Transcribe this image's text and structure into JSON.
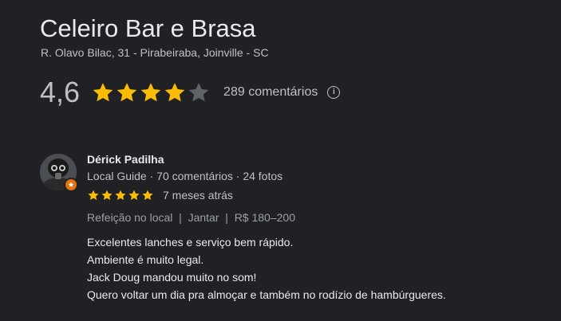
{
  "place": {
    "name": "Celeiro Bar e Brasa",
    "address": "R. Olavo Bilac, 31 - Pirabeiraba, Joinville - SC"
  },
  "rating": {
    "value": "4,6",
    "stars": 4.6,
    "count_label": "289 comentários",
    "star_color": "#fbbc04",
    "empty_star_color": "#5f6368",
    "info_icon": "info-icon"
  },
  "review": {
    "reviewer_name": "Dérick Padilha",
    "reviewer_meta": "Local Guide · 70 comentários · 24 fotos",
    "stars": 5,
    "date": "7 meses atrás",
    "attributes": "Refeição no local  |  Jantar  |  R$ 180–200",
    "text_lines": [
      "Excelentes lanches e serviço bem rápido.",
      "Ambiente é muito legal.",
      "Jack Doug mandou muito no som!",
      "Quero voltar um dia pra almoçar e também no rodízio de hambúrgueres."
    ],
    "badge_color": "#e8710a"
  }
}
